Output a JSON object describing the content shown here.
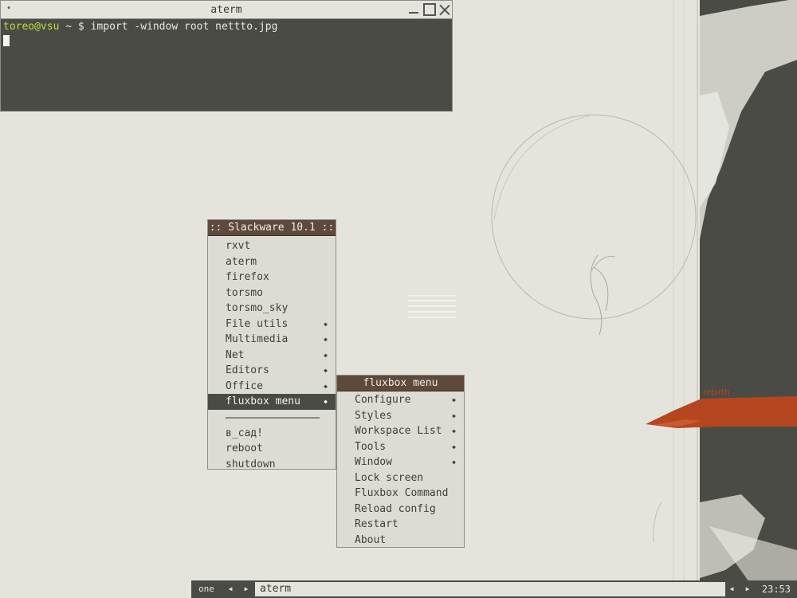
{
  "colors": {
    "desktop_bg": "#e4e4dd",
    "dark_panel": "#4b4b45",
    "menu_title_bg": "#5e4a3d",
    "accent_orange": "#b6461f",
    "prompt_green": "#b6e03a"
  },
  "terminal": {
    "title": "aterm",
    "menu_icon": "•",
    "prompt_user": "toreo@vsu",
    "prompt_rest": " ~ $ ",
    "command": "import -window root nettto.jpg"
  },
  "wallpaper": {
    "label": "rebirth"
  },
  "root_menu": {
    "title": ":: Slackware 10.1 ::",
    "items": [
      {
        "label": "rxvt"
      },
      {
        "label": "aterm"
      },
      {
        "label": "firefox"
      },
      {
        "label": "torsmo"
      },
      {
        "label": "torsmo_sky"
      },
      {
        "label": "File utils"
      },
      {
        "label": "Multimedia"
      },
      {
        "label": "Net"
      },
      {
        "label": "Editors"
      },
      {
        "label": "Office"
      },
      {
        "label": "fluxbox menu"
      },
      {
        "label": "в_сад!"
      },
      {
        "label": "reboot"
      },
      {
        "label": "shutdown"
      }
    ],
    "arrow_glyph": "◆"
  },
  "fluxbox_menu": {
    "title": "fluxbox menu",
    "items": [
      {
        "label": "Configure"
      },
      {
        "label": "Styles"
      },
      {
        "label": "Workspace List"
      },
      {
        "label": "Tools"
      },
      {
        "label": "Window"
      },
      {
        "label": "Lock screen"
      },
      {
        "label": "Fluxbox Command"
      },
      {
        "label": "Reload config"
      },
      {
        "label": "Restart"
      },
      {
        "label": "About"
      }
    ]
  },
  "toolbar": {
    "workspace": "one",
    "prev_glyph": "◀",
    "next_glyph": "▶",
    "task": "aterm",
    "clock": "23:53"
  }
}
